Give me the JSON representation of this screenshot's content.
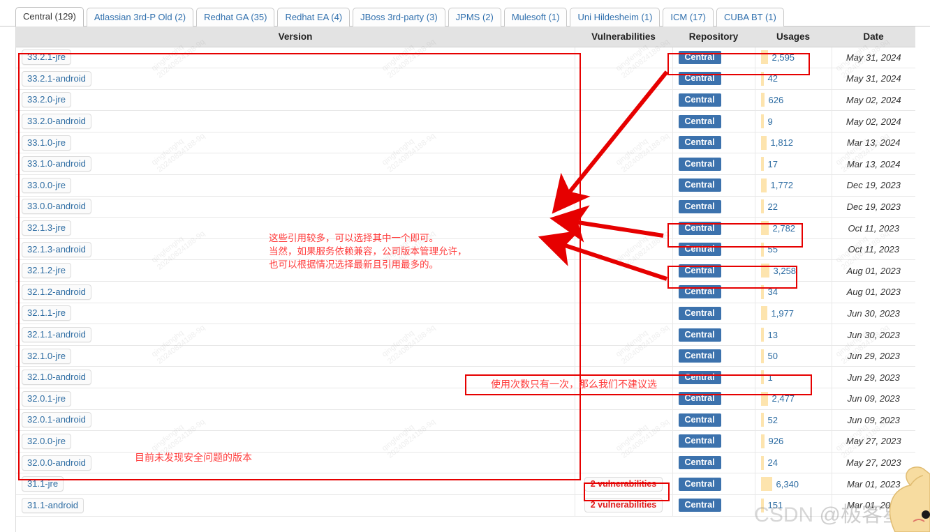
{
  "tabs": [
    {
      "label": "Central (129)",
      "active": true
    },
    {
      "label": "Atlassian 3rd-P Old (2)",
      "active": false
    },
    {
      "label": "Redhat GA (35)",
      "active": false
    },
    {
      "label": "Redhat EA (4)",
      "active": false
    },
    {
      "label": "JBoss 3rd-party (3)",
      "active": false
    },
    {
      "label": "JPMS (2)",
      "active": false
    },
    {
      "label": "Mulesoft (1)",
      "active": false
    },
    {
      "label": "Uni Hildesheim (1)",
      "active": false
    },
    {
      "label": "ICM (17)",
      "active": false
    },
    {
      "label": "CUBA BT (1)",
      "active": false
    }
  ],
  "table": {
    "columns": [
      "Version",
      "Vulnerabilities",
      "Repository",
      "Usages",
      "Date"
    ],
    "rows": [
      {
        "version": "33.2.1-jre",
        "vuln": "",
        "repo": "Central",
        "usages": "2,595",
        "bar": 10,
        "date": "May 31, 2024"
      },
      {
        "version": "33.2.1-android",
        "vuln": "",
        "repo": "Central",
        "usages": "42",
        "bar": 4,
        "date": "May 31, 2024"
      },
      {
        "version": "33.2.0-jre",
        "vuln": "",
        "repo": "Central",
        "usages": "626",
        "bar": 5,
        "date": "May 02, 2024"
      },
      {
        "version": "33.2.0-android",
        "vuln": "",
        "repo": "Central",
        "usages": "9",
        "bar": 4,
        "date": "May 02, 2024"
      },
      {
        "version": "33.1.0-jre",
        "vuln": "",
        "repo": "Central",
        "usages": "1,812",
        "bar": 8,
        "date": "Mar 13, 2024"
      },
      {
        "version": "33.1.0-android",
        "vuln": "",
        "repo": "Central",
        "usages": "17",
        "bar": 4,
        "date": "Mar 13, 2024"
      },
      {
        "version": "33.0.0-jre",
        "vuln": "",
        "repo": "Central",
        "usages": "1,772",
        "bar": 8,
        "date": "Dec 19, 2023"
      },
      {
        "version": "33.0.0-android",
        "vuln": "",
        "repo": "Central",
        "usages": "22",
        "bar": 4,
        "date": "Dec 19, 2023"
      },
      {
        "version": "32.1.3-jre",
        "vuln": "",
        "repo": "Central",
        "usages": "2,782",
        "bar": 11,
        "date": "Oct 11, 2023"
      },
      {
        "version": "32.1.3-android",
        "vuln": "",
        "repo": "Central",
        "usages": "55",
        "bar": 4,
        "date": "Oct 11, 2023"
      },
      {
        "version": "32.1.2-jre",
        "vuln": "",
        "repo": "Central",
        "usages": "3,258",
        "bar": 12,
        "date": "Aug 01, 2023"
      },
      {
        "version": "32.1.2-android",
        "vuln": "",
        "repo": "Central",
        "usages": "34",
        "bar": 4,
        "date": "Aug 01, 2023"
      },
      {
        "version": "32.1.1-jre",
        "vuln": "",
        "repo": "Central",
        "usages": "1,977",
        "bar": 9,
        "date": "Jun 30, 2023"
      },
      {
        "version": "32.1.1-android",
        "vuln": "",
        "repo": "Central",
        "usages": "13",
        "bar": 4,
        "date": "Jun 30, 2023"
      },
      {
        "version": "32.1.0-jre",
        "vuln": "",
        "repo": "Central",
        "usages": "50",
        "bar": 4,
        "date": "Jun 29, 2023"
      },
      {
        "version": "32.1.0-android",
        "vuln": "",
        "repo": "Central",
        "usages": "1",
        "bar": 4,
        "date": "Jun 29, 2023"
      },
      {
        "version": "32.0.1-jre",
        "vuln": "",
        "repo": "Central",
        "usages": "2,477",
        "bar": 10,
        "date": "Jun 09, 2023"
      },
      {
        "version": "32.0.1-android",
        "vuln": "",
        "repo": "Central",
        "usages": "52",
        "bar": 4,
        "date": "Jun 09, 2023"
      },
      {
        "version": "32.0.0-jre",
        "vuln": "",
        "repo": "Central",
        "usages": "926",
        "bar": 5,
        "date": "May 27, 2023"
      },
      {
        "version": "32.0.0-android",
        "vuln": "",
        "repo": "Central",
        "usages": "24",
        "bar": 4,
        "date": "May 27, 2023"
      },
      {
        "version": "31.1-jre",
        "vuln": "2 vulnerabilities",
        "repo": "Central",
        "usages": "6,340",
        "bar": 16,
        "date": "Mar 01, 2023"
      },
      {
        "version": "31.1-android",
        "vuln": "2 vulnerabilities",
        "repo": "Central",
        "usages": "151",
        "bar": 4,
        "date": "Mar 01, 2023"
      }
    ]
  },
  "annotations": {
    "note_many_usages": "这些引用较多，可以选择其中一个即可。\n当然，如果服务依赖兼容，公司版本管理允许，\n也可以根据情况选择最新且引用最多的。",
    "note_single_usage": "使用次数只有一次，那么我们不建议选",
    "note_safe_versions": "目前未发现安全问题的版本"
  },
  "watermarks": {
    "tile_line1": "qingfenghq",
    "tile_line2": "20240824188-9q",
    "csdn_brand": "CSDN",
    "csdn_handle": "@极客星云"
  },
  "colors": {
    "annotation_red": "#ff3b3b",
    "box_red": "#e60000",
    "repo_badge_blue": "#3c72ad",
    "link_blue": "#2d6ca2",
    "usage_bar": "#fde4ae",
    "vuln_red": "#e01b1b",
    "header_bg": "#e3e3e3"
  }
}
